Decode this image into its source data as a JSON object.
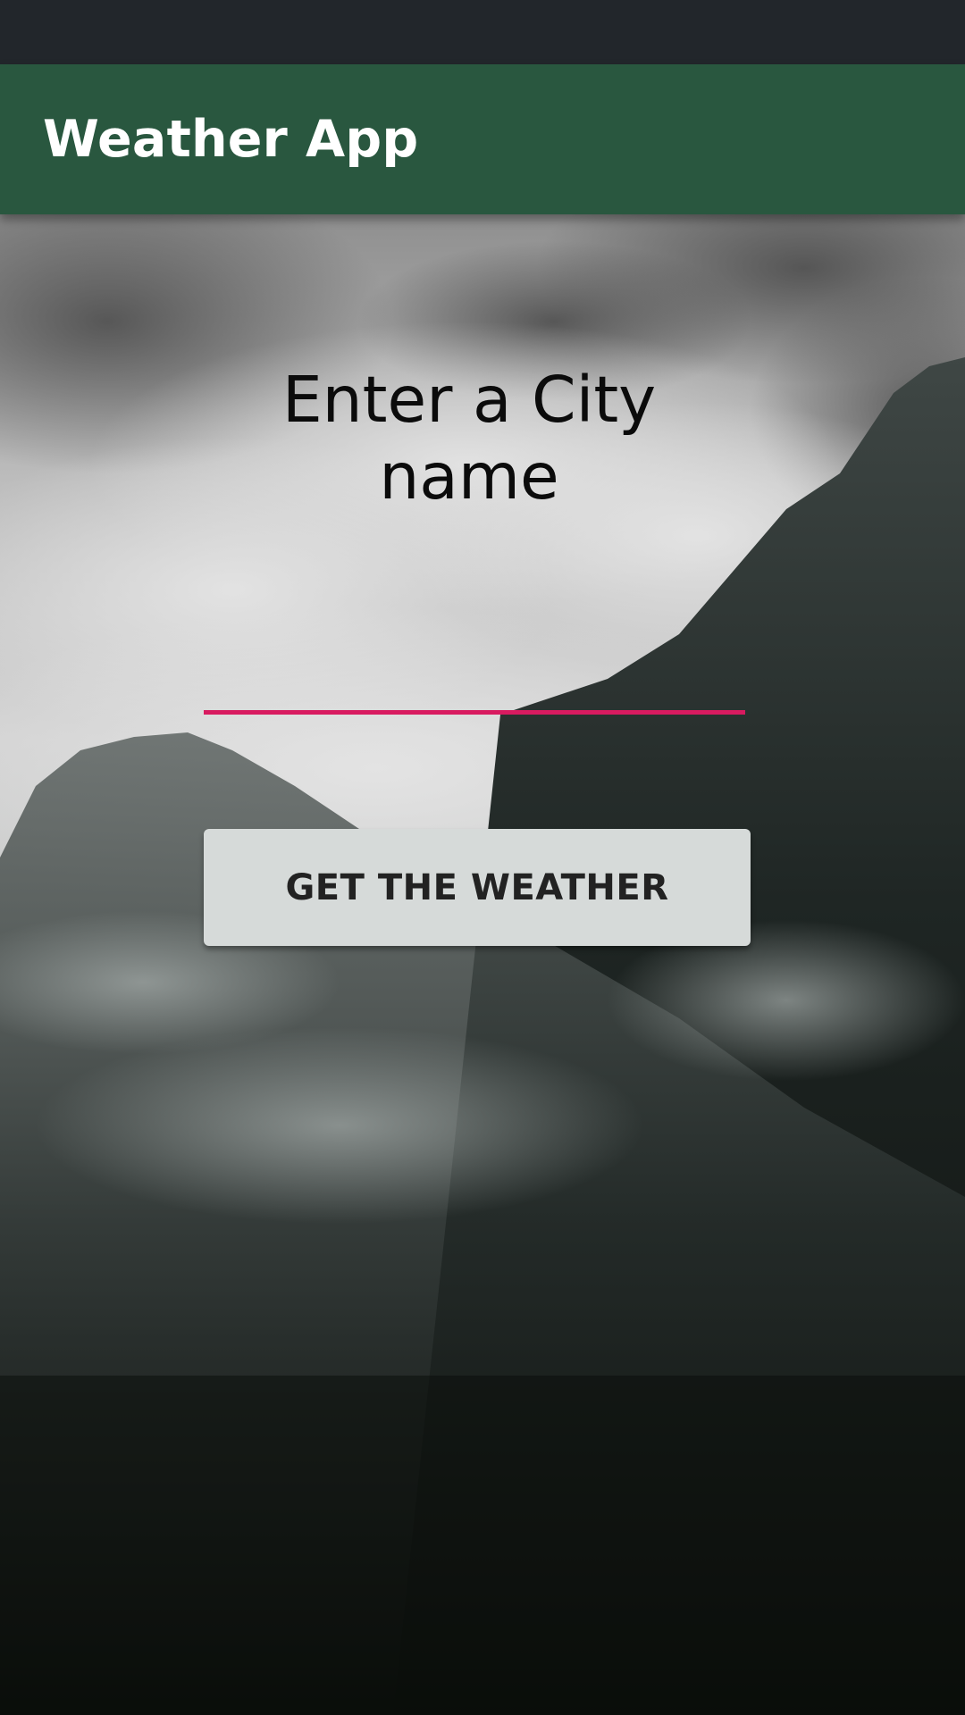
{
  "app_bar": {
    "title": "Weather App",
    "color": "#29573f"
  },
  "status_bar": {
    "color": "#22262b"
  },
  "main": {
    "heading_line1": "Enter a City",
    "heading_line2": "name",
    "city_input": {
      "value": "",
      "placeholder": "",
      "underline_color": "#d81b60"
    },
    "button_label": "GET THE WEATHER"
  },
  "background": {
    "description_icon": "misty-mountain-background"
  }
}
